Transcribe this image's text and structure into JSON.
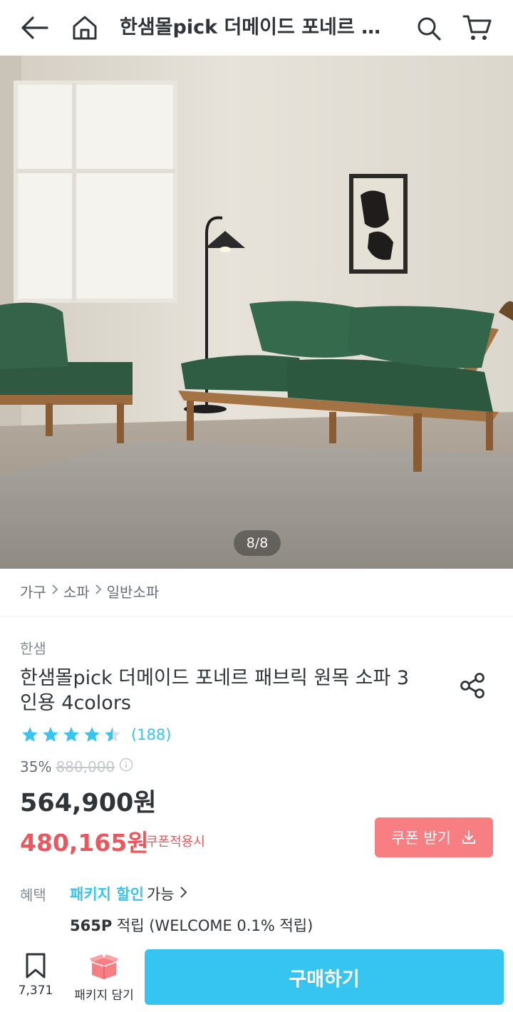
{
  "header": {
    "title": "한샘몰pick 더메이드 포네르 패브릭 원목 소파 3인용 4colors",
    "icons": [
      "back-arrow-icon",
      "home-icon",
      "search-icon",
      "cart-icon"
    ]
  },
  "gallery": {
    "pager": "8/8",
    "current": 8,
    "total": 8
  },
  "breadcrumb": [
    "가구",
    "소파",
    "일반소파"
  ],
  "product": {
    "brand": "한샘",
    "title": "한샘몰pick 더메이드 포네르 패브릭 원목 소파 3인용 4colors",
    "rating": 4.5,
    "review_count": "(188)",
    "discount_rate": "35%",
    "original_price": "880,000",
    "sale_price": "564,900원",
    "coupon_price": "480,165원",
    "coupon_note": "쿠폰적용시",
    "coupon_button": "쿠폰 받기"
  },
  "benefits": {
    "label": "혜택",
    "package_link": "패키지 할인",
    "package_suffix": "가능",
    "point_amount": "565P",
    "point_text": "적립 (WELCOME 0.1% 적립)"
  },
  "bottom_bar": {
    "bookmark_count": "7,371",
    "package_label": "패키지 담기",
    "buy_label": "구매하기"
  },
  "colors": {
    "accent": "#35c5f0",
    "coupon": "#e9585f",
    "coupon_button": "#f77e82",
    "star": "#35c5f0"
  }
}
